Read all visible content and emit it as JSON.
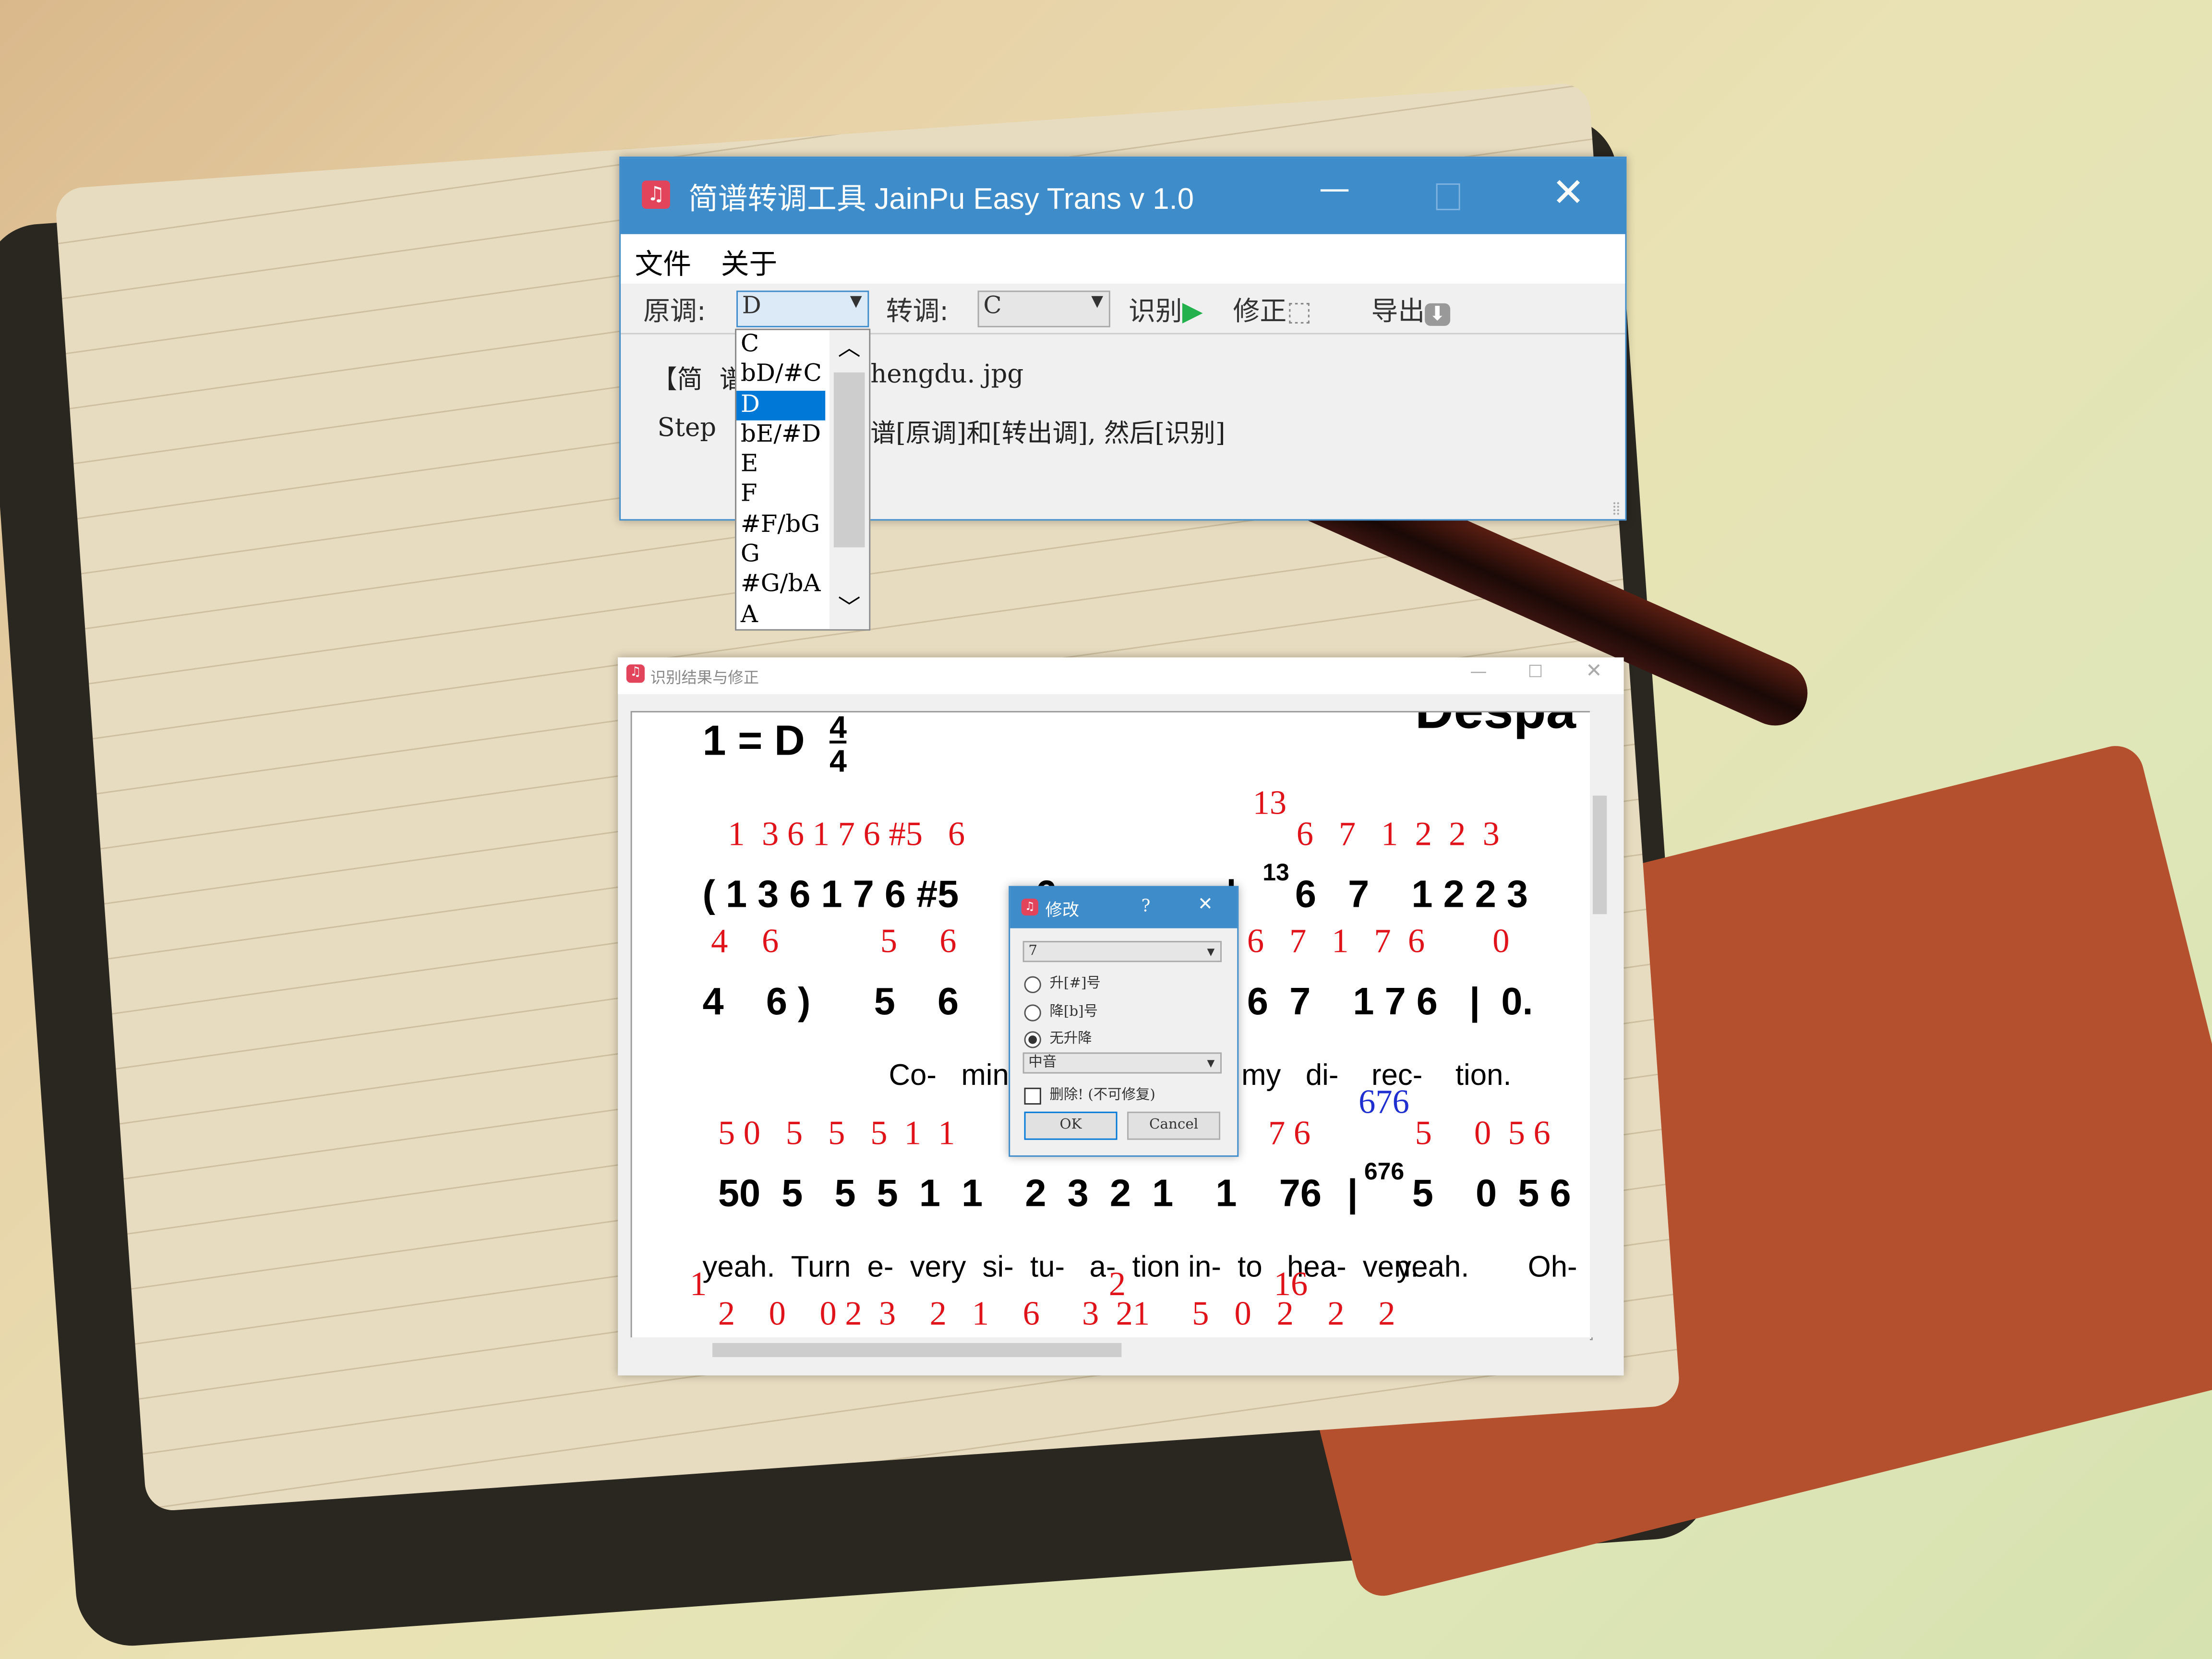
{
  "main_window": {
    "title": "简谱转调工具 JainPu Easy Trans v 1.0",
    "menu": [
      "文件",
      "关于"
    ],
    "toolbar": {
      "original_key_label": "原调:",
      "original_key_value": "D",
      "target_key_label": "转调:",
      "target_key_value": "C",
      "recognize_label": "识别",
      "correct_label": "修正",
      "export_label": "导出"
    },
    "content": {
      "line1_left": "【简",
      "line1_mid": "谱",
      "line1_right": "hengdu. jpg",
      "line2_left": "Step",
      "line2_right": "谱[原调]和[转出调], 然后[识别]"
    },
    "key_dropdown": {
      "options": [
        "C",
        "bD/#C",
        "D",
        "bE/#D",
        "E",
        "F",
        "#F/bG",
        "G",
        "#G/bA",
        "A"
      ],
      "selected": "D"
    }
  },
  "result_window": {
    "title": "识别结果与修正",
    "score": {
      "header": "1 = D",
      "time_sig": [
        "4",
        "4"
      ],
      "title_partial": "Despa",
      "rows": [
        {
          "red": "1  3 6 1 7 6 #5   6",
          "red_b": "13",
          "red_c": "6   7   1  2  2  3"
        },
        {
          "black": "( 1 3 6 1 7 6 #5",
          "black_b": "6",
          "black_c": "13",
          "black_d": "6   7    1 2 2 3"
        },
        {
          "red": "4    6            5     6",
          "red_c": "6   7   1   7  6        0"
        },
        {
          "black": "4    6 )      5    6",
          "black_c": "6  7    1 7 6   |  0."
        },
        {
          "lyric": "Co-   min'",
          "lyric_c": "my   di-    rec-    tion."
        },
        {
          "red": "5 0   5   5   5  1  1",
          "red_b": "7 6",
          "red_blue": "676",
          "red_c": "5     0  5 6"
        },
        {
          "black": "50  5   5  5  1  1    2  3  2  1    1    76",
          "black_c": "676",
          "black_d": "5    0  5 6"
        },
        {
          "lyric": "yeah.  Turn  e-  very  si-  tu-   a-  tion in-  to   hea-  ven.",
          "lyric_c": "yeah.",
          "lyric_d": "Oh-"
        },
        {
          "red": "2    0    0 2  3    2   1    6     3  21     5   0   2    2    2",
          "red_b": "1",
          "red_c": "2",
          "red_d": "16"
        }
      ]
    }
  },
  "modify_dialog": {
    "title": "修改",
    "help": "?",
    "note_value": "7",
    "radios": [
      {
        "label": "升[#]号",
        "checked": false
      },
      {
        "label": "降[b]号",
        "checked": false
      },
      {
        "label": "无升降",
        "checked": true
      }
    ],
    "octave_value": "中音",
    "delete_label": "删除! (不可修复)",
    "delete_checked": false,
    "ok_label": "OK",
    "cancel_label": "Cancel"
  },
  "colors": {
    "titlebar": "#3f8ccb",
    "selection": "#0078d7",
    "note_red": "#e0121a",
    "play_green": "#22b14c"
  }
}
